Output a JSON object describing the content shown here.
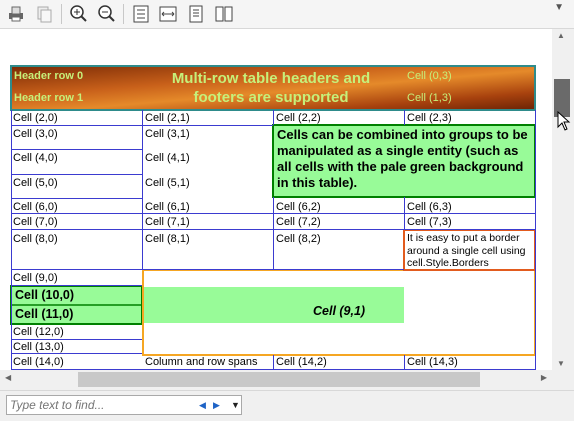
{
  "toolbar": {
    "buttons": [
      {
        "name": "print-icon"
      },
      {
        "name": "copy-icon"
      },
      {
        "name": "zoom-in-icon"
      },
      {
        "name": "zoom-out-icon"
      },
      {
        "name": "fit-page-icon"
      },
      {
        "name": "fit-width-icon"
      },
      {
        "name": "single-page-icon"
      },
      {
        "name": "two-page-icon"
      }
    ]
  },
  "table": {
    "header_rows": [
      "Header row 0",
      "Header row 1"
    ],
    "header_title": "Multi-row table headers and footers are supported",
    "header_cells": [
      "Cell (0,3)",
      "Cell (1,3)"
    ],
    "group_note": "Cells can be combined into groups to be manipulated as a single entity (such as all cells with the pale green background in this table).",
    "border_note": "It is easy to put a border around a single cell using cell.Style.Borders",
    "span_note": "Column and row spans",
    "merged_cell": "Cell (9,1)",
    "rows": [
      [
        "Cell (2,0)",
        "Cell (2,1)",
        "Cell (2,2)",
        "Cell (2,3)"
      ],
      [
        "Cell (3,0)",
        "Cell (3,1)"
      ],
      [
        "Cell (4,0)",
        "Cell (4,1)"
      ],
      [
        "Cell (5,0)",
        "Cell (5,1)"
      ],
      [
        "Cell (6,0)",
        "Cell (6,1)",
        "Cell (6,2)",
        "Cell (6,3)"
      ],
      [
        "Cell (7,0)",
        "Cell (7,1)",
        "Cell (7,2)",
        "Cell (7,3)"
      ],
      [
        "Cell (8,0)",
        "Cell (8,1)",
        "Cell (8,2)"
      ],
      [
        "Cell (9,0)"
      ],
      [
        "Cell (10,0)"
      ],
      [
        "Cell (11,0)"
      ],
      [
        "Cell (12,0)"
      ],
      [
        "Cell (13,0)"
      ],
      [
        "Cell (14,0)",
        "Cell (14,2)",
        "Cell (14,3)"
      ]
    ]
  },
  "find": {
    "placeholder": "Type text to find..."
  },
  "colors": {
    "grid": "#3b3bd0",
    "pale_green": "#98fb98",
    "dark_green_border": "#008000",
    "orange_border": "#f5a623",
    "red_border": "#e25b1e",
    "header_text": "#c6f07a"
  }
}
